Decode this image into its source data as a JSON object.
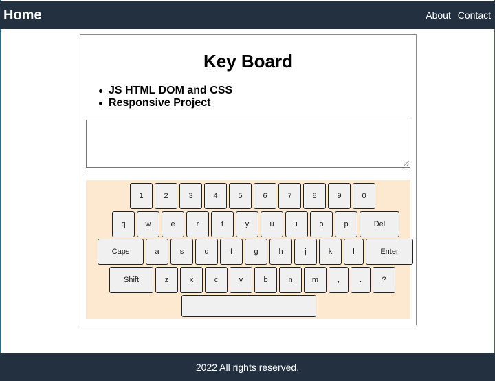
{
  "header": {
    "brand": "Home",
    "nav": [
      "About",
      "Contact"
    ]
  },
  "main": {
    "title": "Key Board",
    "bullets": [
      "JS HTML DOM and CSS",
      "Responsive Project"
    ],
    "textarea_value": ""
  },
  "keyboard": {
    "rows": [
      [
        "1",
        "2",
        "3",
        "4",
        "5",
        "6",
        "7",
        "8",
        "9",
        "0"
      ],
      [
        "q",
        "w",
        "e",
        "r",
        "t",
        "y",
        "u",
        "i",
        "o",
        "p",
        "Del"
      ],
      [
        "Caps",
        "a",
        "s",
        "d",
        "f",
        "g",
        "h",
        "j",
        "k",
        "l",
        "Enter"
      ],
      [
        "Shift",
        "z",
        "x",
        "c",
        "v",
        "b",
        "n",
        "m",
        ",",
        ".",
        "?"
      ],
      [
        ""
      ]
    ]
  },
  "footer": {
    "text": "2022 All rights reserved."
  },
  "colors": {
    "navbar": "#223040",
    "keyboard_panel": "#fde9cf",
    "key_bg": "#f0f0f0"
  }
}
